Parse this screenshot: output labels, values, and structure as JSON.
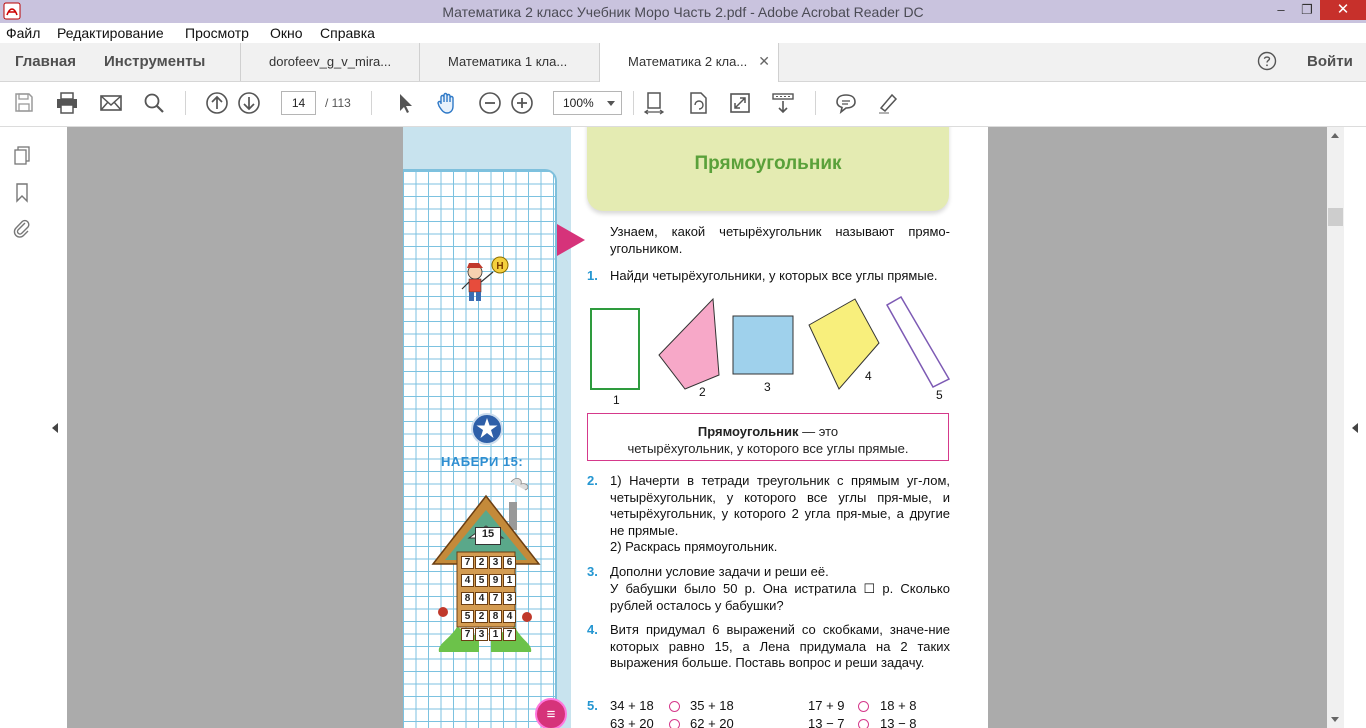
{
  "window": {
    "title": "Математика 2 класс Учебник Моро Часть 2.pdf - Adobe Acrobat Reader DC",
    "min_glyph": "–",
    "max_glyph": "❐",
    "close_glyph": "✕"
  },
  "menu": [
    "Файл",
    "Редактирование",
    "Просмотр",
    "Окно",
    "Справка"
  ],
  "tabs": {
    "home": "Главная",
    "tools": "Инструменты",
    "docs": [
      "dorofeev_g_v_mira...",
      "Математика 1 кла...",
      "Математика 2 кла..."
    ],
    "active_index": 2,
    "close_glyph": "✕",
    "login": "Войти"
  },
  "toolbar": {
    "page_current": "14",
    "page_total": "/ 113",
    "zoom": "100%"
  },
  "book": {
    "title": "Прямоугольник",
    "intro": "Узнаем, какой четырёхугольник называют прямо-угольником.",
    "side_label": "НАБЕРИ 15:",
    "house_number": "15",
    "house_grid": [
      [
        "7",
        "2",
        "3",
        "6"
      ],
      [
        "4",
        "5",
        "9",
        "1"
      ],
      [
        "8",
        "4",
        "7",
        "3"
      ],
      [
        "5",
        "2",
        "8",
        "4"
      ],
      [
        "7",
        "3",
        "1",
        "7"
      ]
    ],
    "tasks": [
      {
        "num": "1.",
        "text": "Найди четырёхугольники, у которых все углы прямые."
      },
      {
        "num": "2.",
        "text": "1) Начерти в тетради треугольник с прямым уг-лом, четырёхугольник, у которого все углы пря-мые, и четырёхугольник, у которого 2 угла пря-мые, а другие не прямые.",
        "text2": "2) Раскрась прямоугольник."
      },
      {
        "num": "3.",
        "text": "Дополни условие задачи и реши её.",
        "text2": "У бабушки было 50 р. Она истратила ☐ р. Сколько рублей осталось у бабушки?"
      },
      {
        "num": "4.",
        "text": "Витя придумал 6 выражений со скобками, значе-ние которых равно 15, а Лена придумала на 2 таких выражения больше. Поставь вопрос и реши задачу."
      },
      {
        "num": "5."
      }
    ],
    "shape_labels": [
      "1",
      "2",
      "3",
      "4",
      "5"
    ],
    "definition_bold": "Прямоугольник",
    "definition_rest": " — это",
    "definition_line2": "четырёхугольник, у которого все углы прямые.",
    "expressions": [
      [
        "34 + 18",
        "35 + 18",
        "17 + 9",
        "18 + 8"
      ],
      [
        "63 + 20",
        "62 + 20",
        "13 − 7",
        "13 − 8"
      ]
    ]
  },
  "colors": {
    "title_bar": "#c9c3de",
    "close_button": "#c7302b",
    "book_heading": "#5aa13a",
    "task_numbers": "#2496d1",
    "accent_pink": "#d6337a"
  }
}
